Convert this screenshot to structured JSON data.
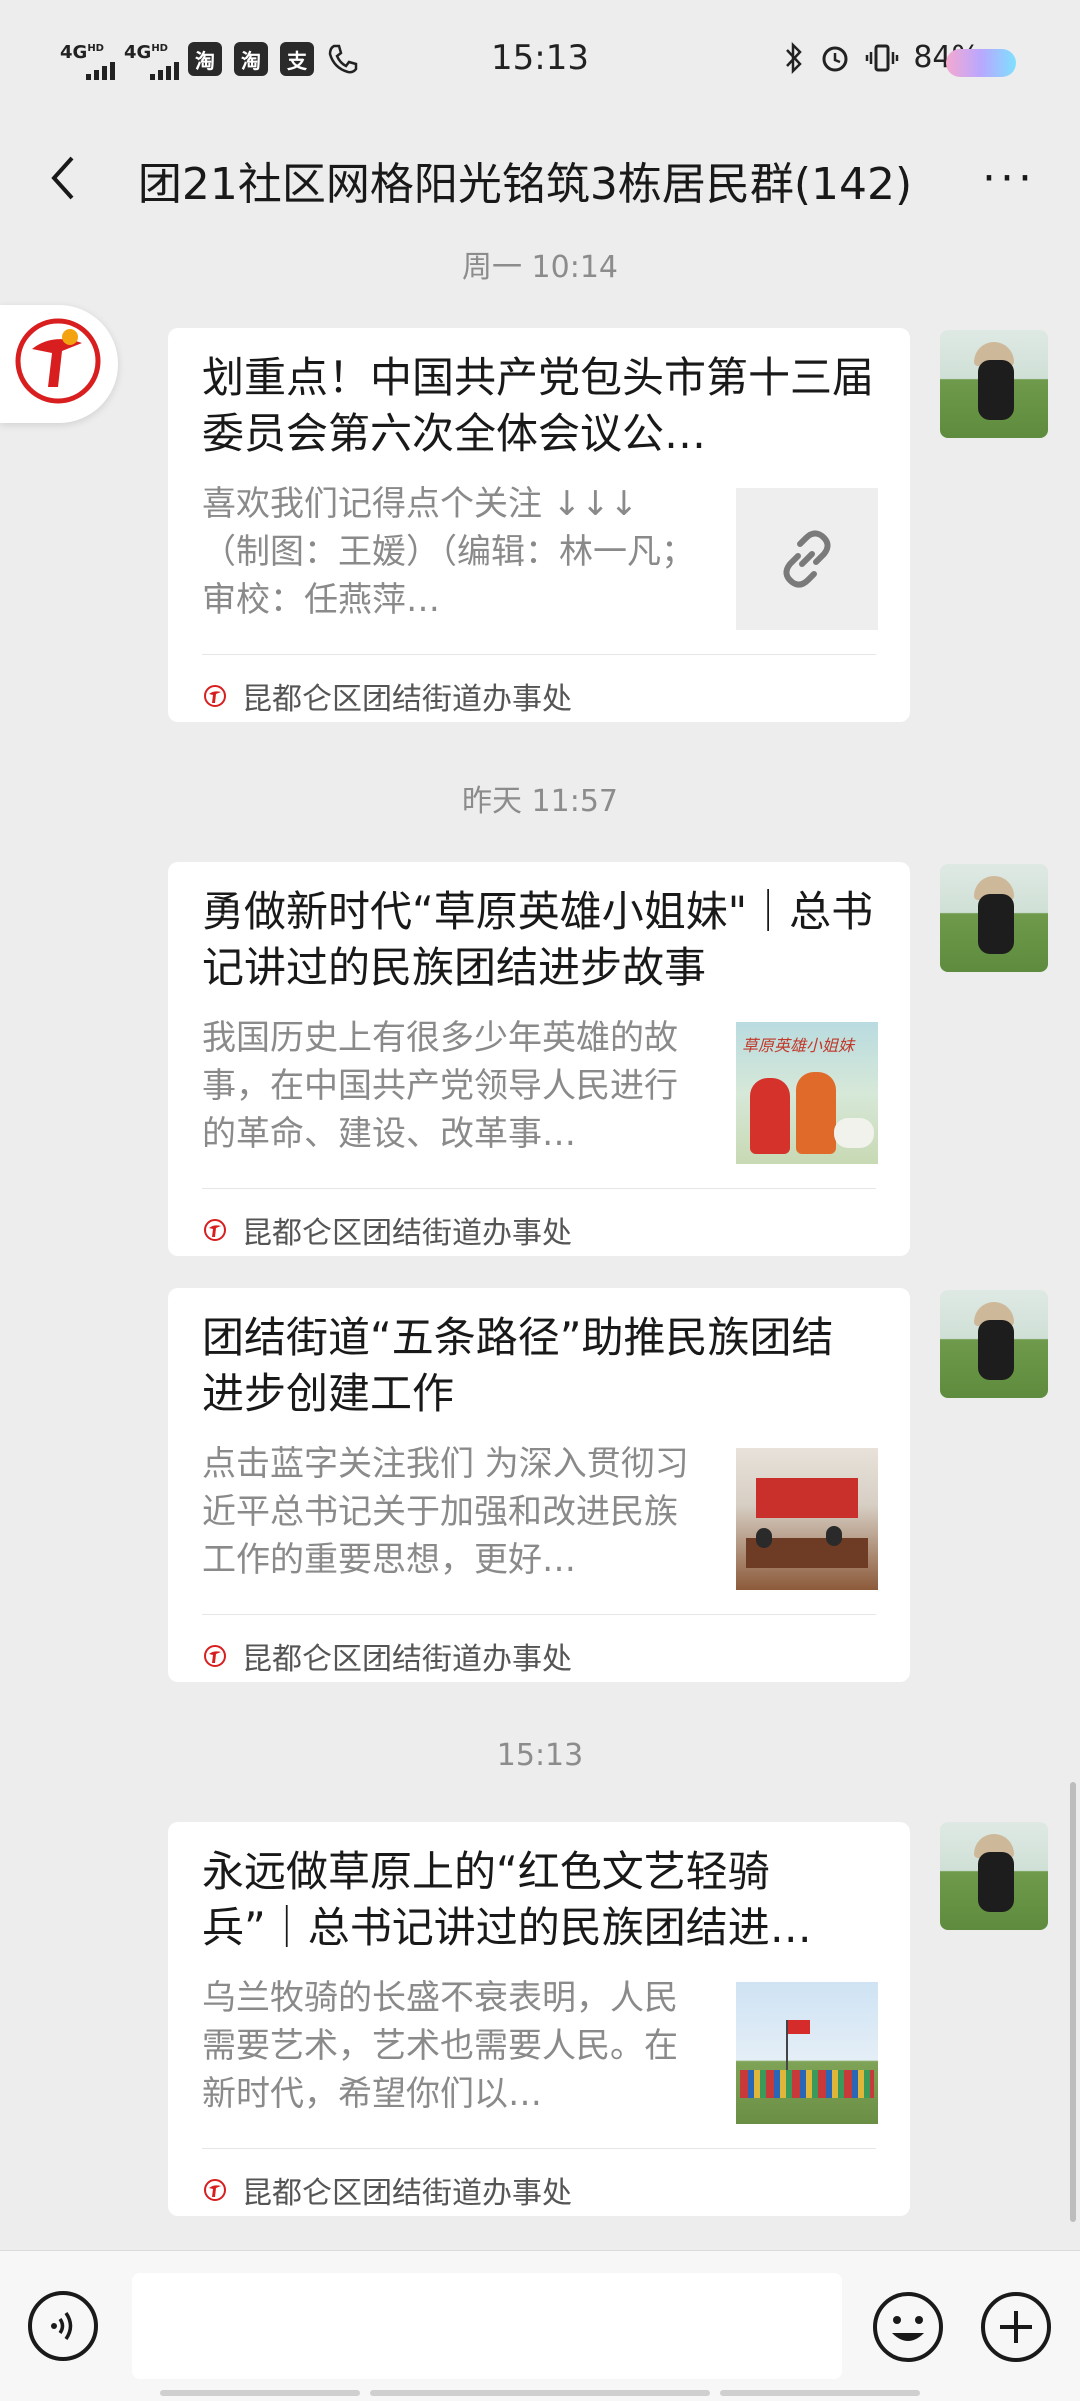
{
  "status": {
    "net1": "4G",
    "net2": "4G",
    "apps": [
      "淘",
      "淘",
      "支"
    ],
    "time": "15:13",
    "battery": "84%"
  },
  "header": {
    "title": "团21社区网格阳光铭筑3栋居民群(142)"
  },
  "messages": [
    {
      "timestamp": "周一 10:14",
      "title": "划重点！中国共产党包头市第十三届委员会第六次全体会议公…",
      "desc": "喜欢我们记得点个关注 ↓↓↓（制图：王媛）（编辑：林一凡；审校：任燕萍…",
      "source": "昆都仑区团结街道办事处",
      "thumb": "link-icon"
    },
    {
      "timestamp": "昨天 11:57",
      "title": "勇做新时代“草原英雄小姐妹\"｜总书记讲过的民族团结进步故事",
      "desc": "我国历史上有很多少年英雄的故事，在中国共产党领导人民进行的革命、建设、改革事…",
      "source": "昆都仑区团结街道办事处",
      "thumb": "image",
      "thumb_text": "草原英雄小姐妹"
    },
    {
      "timestamp": "",
      "title": "团结街道“五条路径”助推民族团结进步创建工作",
      "desc": "点击蓝字关注我们 为深入贯彻习近平总书记关于加强和改进民族工作的重要思想，更好…",
      "source": "昆都仑区团结街道办事处",
      "thumb": "image"
    },
    {
      "timestamp": "15:13",
      "title": "永远做草原上的“红色文艺轻骑兵”｜总书记讲过的民族团结进…",
      "desc": "乌兰牧骑的长盛不衰表明，人民需要艺术，艺术也需要人民。在新时代，希望你们以…",
      "source": "昆都仑区团结街道办事处",
      "thumb": "image"
    }
  ],
  "colors": {
    "background": "#ededed",
    "card": "#ffffff",
    "timestamp": "#8c8c8c",
    "desc": "#8a8a8a"
  }
}
